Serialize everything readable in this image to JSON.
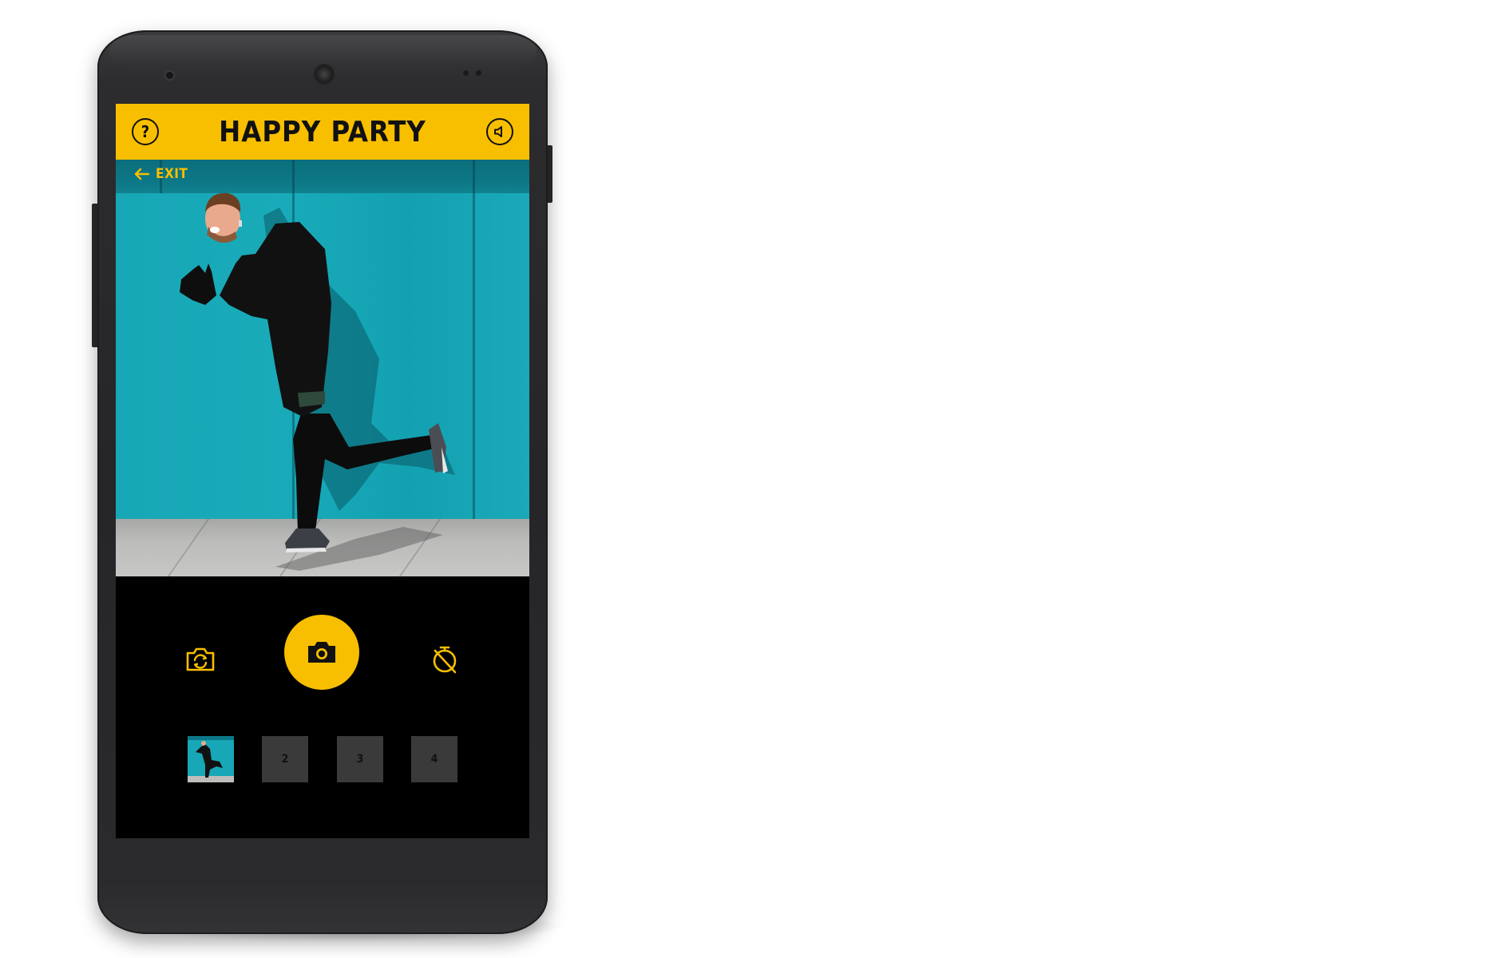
{
  "app": {
    "title": "HAPPY PARTY"
  },
  "header": {
    "help_icon": "help-circle-icon",
    "sound_icon": "speaker-icon"
  },
  "preview": {
    "exit_label": "EXIT",
    "exit_icon": "arrow-left-icon"
  },
  "controls": {
    "switch_camera_icon": "camera-switch-icon",
    "shutter_icon": "camera-icon",
    "timer_icon": "timer-off-icon"
  },
  "thumbnails": [
    {
      "label": "",
      "filled": true
    },
    {
      "label": "2",
      "filled": false
    },
    {
      "label": "3",
      "filled": false
    },
    {
      "label": "4",
      "filled": false
    }
  ],
  "colors": {
    "accent": "#f8bf00",
    "screen_bg": "#000000",
    "wall": "#17a7b6",
    "phone_body": "#2a2a2c"
  }
}
